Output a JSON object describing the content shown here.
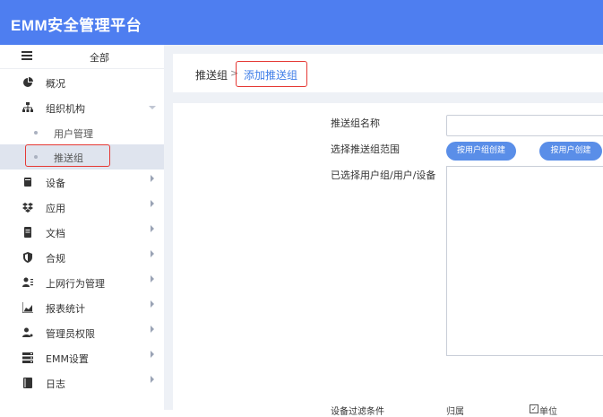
{
  "app": {
    "title": "EMM安全管理平台"
  },
  "sidebar": {
    "all_label": "全部",
    "items": [
      {
        "label": "概况",
        "icon": "pie-chart-icon"
      },
      {
        "label": "组织机构",
        "icon": "org-chart-icon"
      },
      {
        "label": "用户管理"
      },
      {
        "label": "推送组"
      },
      {
        "label": "设备",
        "icon": "device-icon"
      },
      {
        "label": "应用",
        "icon": "dropbox-icon"
      },
      {
        "label": "文档",
        "icon": "document-icon"
      },
      {
        "label": "合规",
        "icon": "shield-icon"
      },
      {
        "label": "上网行为管理",
        "icon": "user-list-icon"
      },
      {
        "label": "报表统计",
        "icon": "area-chart-icon"
      },
      {
        "label": "管理员权限",
        "icon": "user-key-icon"
      },
      {
        "label": "EMM设置",
        "icon": "settings-list-icon"
      },
      {
        "label": "日志",
        "icon": "log-book-icon"
      }
    ]
  },
  "breadcrumb": {
    "parent": "推送组",
    "separator": ">",
    "current": "添加推送组"
  },
  "form": {
    "name_label": "推送组名称",
    "name_value": "",
    "scope_label": "选择推送组范围",
    "btn_by_group": "按用户组创建",
    "btn_by_user": "按用户创建",
    "selected_label": "已选择用户组/用户/设备",
    "filter_label": "设备过滤条件",
    "filter_opt1": "归属",
    "filter_opt2": "单位"
  },
  "colors": {
    "header": "#4e7ef0",
    "accent": "#3f7ee8",
    "highlight": "#e53935"
  }
}
